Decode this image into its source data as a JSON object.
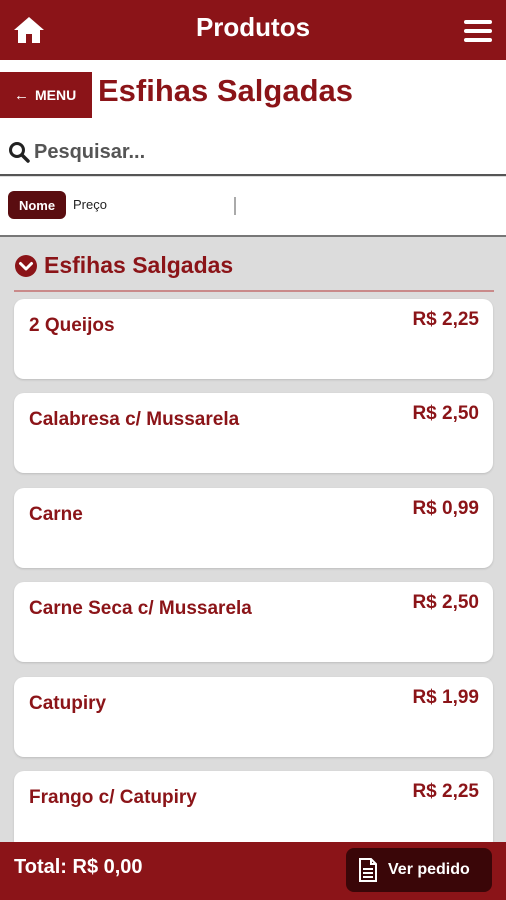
{
  "topbar": {
    "title": "Produtos",
    "home_icon": "home-icon",
    "menu_icon": "hamburger-menu-icon"
  },
  "header": {
    "menu_label": "MENU",
    "page_title": "Esfihas Salgadas"
  },
  "search": {
    "placeholder": "Pesquisar..."
  },
  "sort": {
    "nome_label": "Nome",
    "preco_label": "Preço"
  },
  "section": {
    "label": "Esfihas Salgadas"
  },
  "products": [
    {
      "name": "2 Queijos",
      "price": "R$ 2,25"
    },
    {
      "name": "Calabresa c/ Mussarela",
      "price": "R$ 2,50"
    },
    {
      "name": "Carne",
      "price": "R$ 0,99"
    },
    {
      "name": "Carne Seca c/ Mussarela",
      "price": "R$ 2,50"
    },
    {
      "name": "Catupiry",
      "price": "R$ 1,99"
    },
    {
      "name": "Frango c/ Catupiry",
      "price": "R$ 2,25"
    }
  ],
  "footer": {
    "total": "Total: R$ 0,00",
    "ver_pedido": "Ver pedido"
  },
  "colors": {
    "brand": "#8b1418",
    "dark": "#3a0608",
    "background": "#dcdcdc"
  }
}
